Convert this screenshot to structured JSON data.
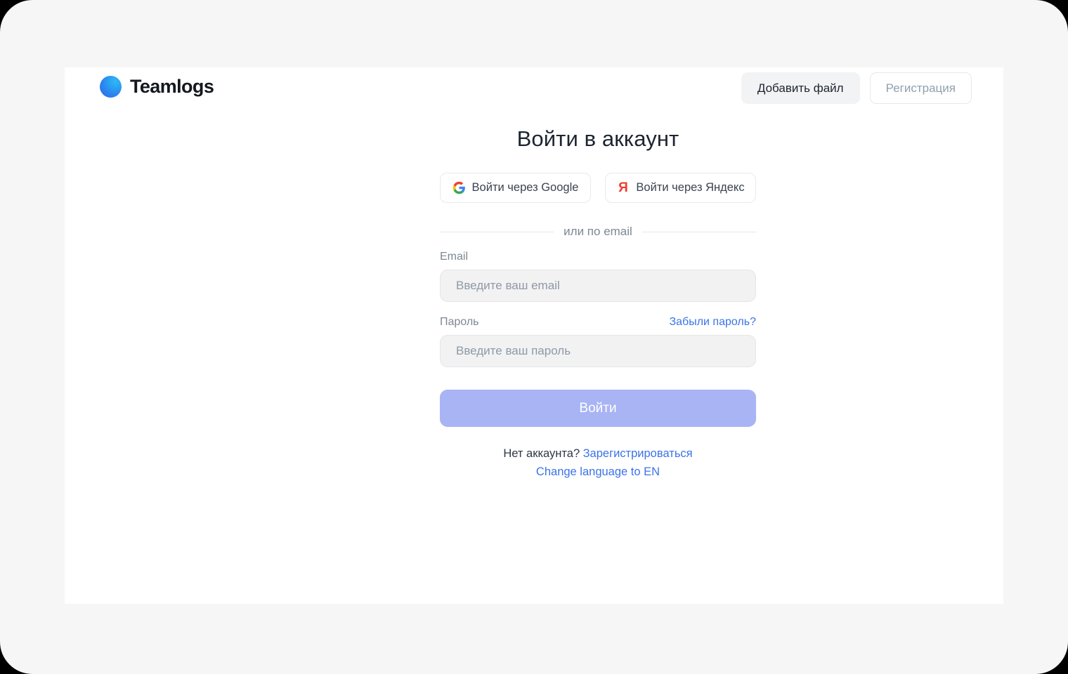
{
  "header": {
    "brand_name": "Teamlogs",
    "logo_icon": "teamlogs-sphere-logo",
    "add_file_label": "Добавить файл",
    "register_label": "Регистрация"
  },
  "auth": {
    "title": "Войти в аккаунт",
    "oauth": [
      {
        "label": "Войти через Google",
        "icon": "google-icon"
      },
      {
        "label": "Войти через Яндекс",
        "icon": "yandex-icon",
        "glyph": "Я"
      }
    ],
    "divider_text": "или по email",
    "email": {
      "label": "Email",
      "placeholder": "Введите ваш email",
      "value": ""
    },
    "password": {
      "label": "Пароль",
      "placeholder": "Введите ваш пароль",
      "value": "",
      "forgot_label": "Забыли пароль?"
    },
    "submit_label": "Войти",
    "footer": {
      "no_account_text": "Нет аккаунта?",
      "register_link": "Зарегистрироваться",
      "language_link": "Change language to EN"
    }
  },
  "colors": {
    "accent_blue": "#3b73e8",
    "submit_bg": "#a8b4f4",
    "brand_dark": "#14171f",
    "muted_text": "#7d8794",
    "yandex_red": "#f23b2f",
    "panel_bg": "#ffffff",
    "page_bg": "#f6f6f7"
  }
}
